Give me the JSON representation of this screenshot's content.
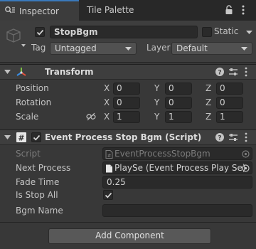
{
  "tabs": [
    {
      "label": "Inspector",
      "active": true
    },
    {
      "label": "Tile Palette",
      "active": false
    }
  ],
  "gameobject": {
    "active": true,
    "name": "StopBgm",
    "static_label": "Static",
    "static_checked": false,
    "tag_label": "Tag",
    "tag_value": "Untagged",
    "layer_label": "Layer",
    "layer_value": "Default"
  },
  "transform": {
    "title": "Transform",
    "rows": [
      {
        "label": "Position",
        "x": "0",
        "y": "0",
        "z": "0"
      },
      {
        "label": "Rotation",
        "x": "0",
        "y": "0",
        "z": "0"
      },
      {
        "label": "Scale",
        "x": "1",
        "y": "1",
        "z": "1"
      }
    ],
    "axes": {
      "x": "X",
      "y": "Y",
      "z": "Z"
    }
  },
  "script_component": {
    "title": "Event Process Stop Bgm (Script)",
    "enabled": true,
    "fields": {
      "script_label": "Script",
      "script_value": "EventProcessStopBgm",
      "next_label": "Next Process",
      "next_value": "PlaySe (Event Process Play Se)",
      "fade_label": "Fade Time",
      "fade_value": "0.25",
      "stopall_label": "Is Stop All",
      "stopall_checked": true,
      "bgm_label": "Bgm Name",
      "bgm_value": ""
    }
  },
  "add_component_label": "Add Component",
  "colors": {
    "accent": "#3a79bb",
    "panel": "#383838",
    "tabbar": "#282828",
    "field": "#2a2a2a"
  }
}
